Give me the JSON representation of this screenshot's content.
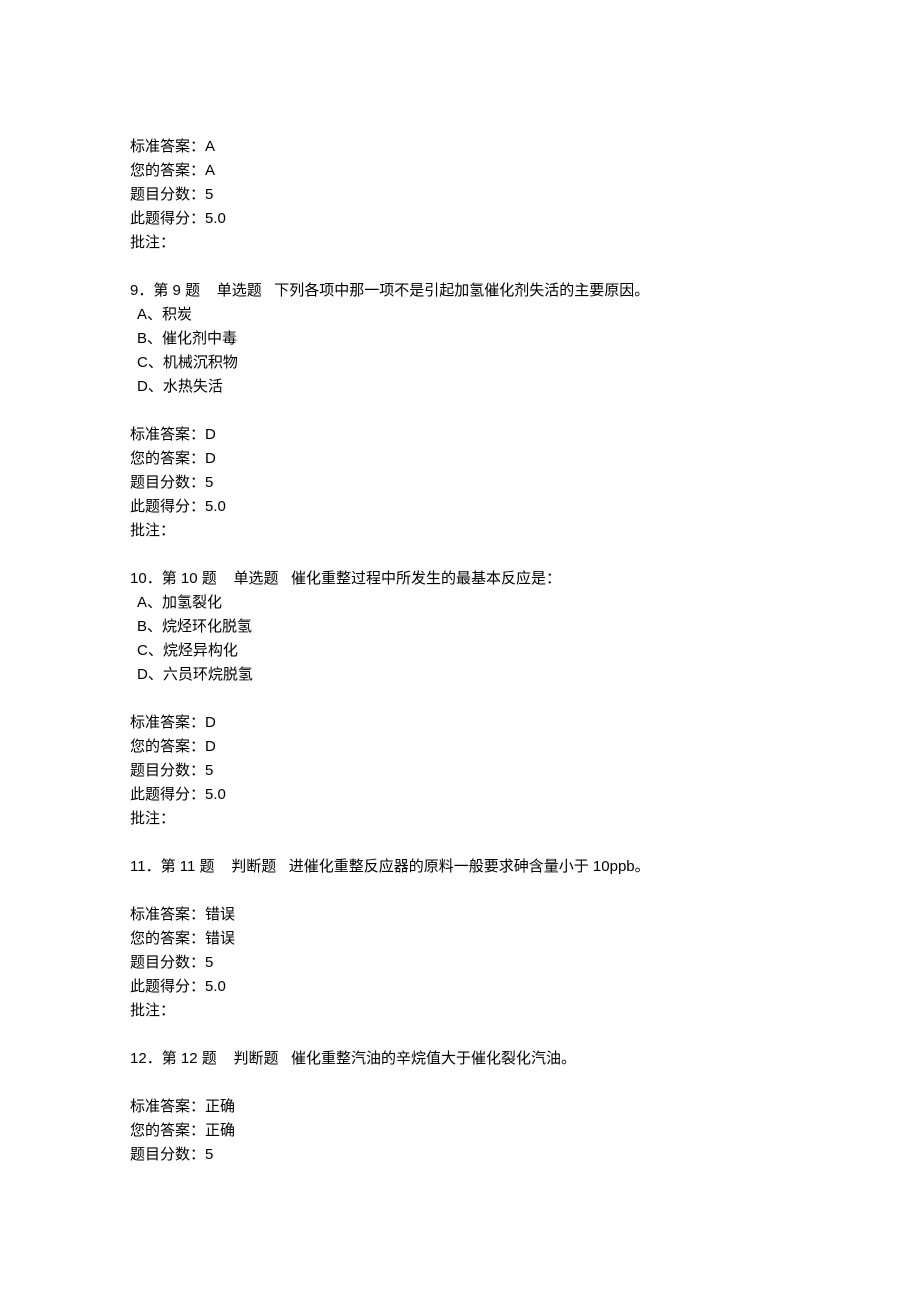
{
  "lbl": {
    "std": "标准答案：",
    "your": "您的答案：",
    "pts": "题目分数：",
    "earned": "此题得分：",
    "note": "批注：",
    "di": "第",
    "ti": "题",
    "single": "单选题",
    "judge": "判断题"
  },
  "q8": {
    "std": "A",
    "your": "A",
    "pts": "5",
    "earned": "5.0",
    "note": ""
  },
  "q9": {
    "num": "9",
    "qno": "9",
    "text": "下列各项中那一项不是引起加氢催化剂失活的主要原因。",
    "opts": {
      "A": "A、积炭",
      "B": "B、催化剂中毒",
      "C": "C、机械沉积物",
      "D": "D、水热失活"
    },
    "std": "D",
    "your": "D",
    "pts": "5",
    "earned": "5.0",
    "note": ""
  },
  "q10": {
    "num": "10",
    "qno": "10",
    "text": "催化重整过程中所发生的最基本反应是：",
    "opts": {
      "A": "A、加氢裂化",
      "B": "B、烷烃环化脱氢",
      "C": "C、烷烃异构化",
      "D": "D、六员环烷脱氢"
    },
    "std": "D",
    "your": "D",
    "pts": "5",
    "earned": "5.0",
    "note": ""
  },
  "q11": {
    "num": "11",
    "qno": "11",
    "text": "进催化重整反应器的原料一般要求砷含量小于 10ppb。",
    "std": "错误",
    "your": "错误",
    "pts": "5",
    "earned": "5.0",
    "note": ""
  },
  "q12": {
    "num": "12",
    "qno": "12",
    "text": "催化重整汽油的辛烷值大于催化裂化汽油。",
    "std": "正确",
    "your": "正确",
    "pts": "5"
  }
}
